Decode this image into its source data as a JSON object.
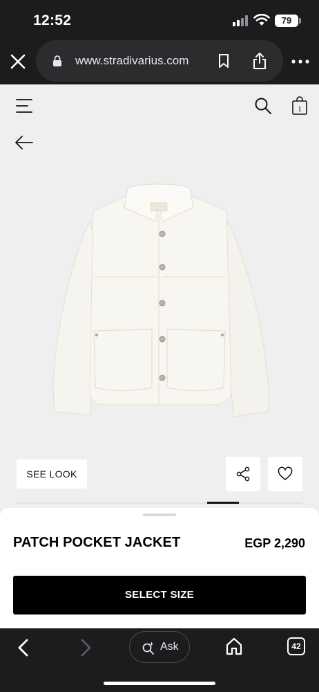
{
  "status_bar": {
    "time": "12:52",
    "battery": "79",
    "icons": [
      "signal-icon",
      "wifi-icon",
      "battery-icon"
    ]
  },
  "browser": {
    "url": "www.stradivarius.com",
    "icons": [
      "close-icon",
      "lock-icon",
      "bookmark-icon",
      "share-icon",
      "more-icon"
    ]
  },
  "header": {
    "icons": [
      "menu-icon",
      "search-icon",
      "bag-icon",
      "back-arrow-icon"
    ],
    "cart_count": "1"
  },
  "product": {
    "image": "white-jacket-image",
    "see_look_label": "SEE LOOK",
    "name": "PATCH POCKET JACKET",
    "price": "EGP 2,290",
    "select_size_label": "SELECT SIZE",
    "carousel": {
      "active_index": 7,
      "total": 9
    }
  },
  "toolbar": {
    "ask_label": "Ask",
    "tab_count": "42",
    "icons": [
      "back-icon",
      "forward-icon",
      "ask-icon",
      "home-icon",
      "tabs-icon"
    ]
  },
  "colors": {
    "chrome": "#1c1c1e",
    "page_bg": "#efeff0",
    "button": "#000000"
  }
}
